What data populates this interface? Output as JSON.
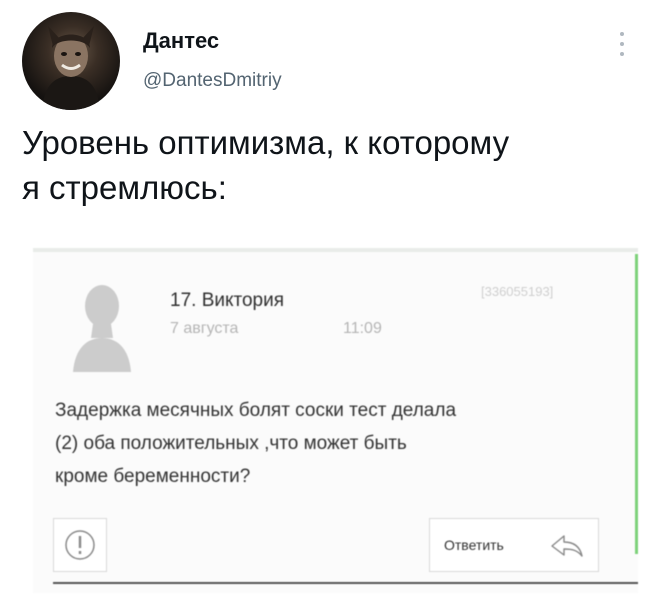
{
  "tweet": {
    "author": {
      "display_name": "Дантес",
      "handle": "@DantesDmitriy",
      "avatar_icon": "avatar-photo"
    },
    "more_icon": "vertical-dots-icon",
    "text_lines": [
      "Уровень оптимизма, к которому",
      "я стремлюсь:"
    ]
  },
  "embedded_post": {
    "author": "17. Виктория",
    "date": "7 августа",
    "time": "11:09",
    "message_id": "[336055193]",
    "question_lines": [
      "Задержка месячных болят соски тест делала",
      "(2) оба положительных ,что может быть",
      "кроме беременности?"
    ],
    "complain_icon": "exclamation-circle-icon",
    "reply_label": "Ответить",
    "reply_icon": "reply-arrow-icon",
    "accent_color": "#7ed27a"
  }
}
